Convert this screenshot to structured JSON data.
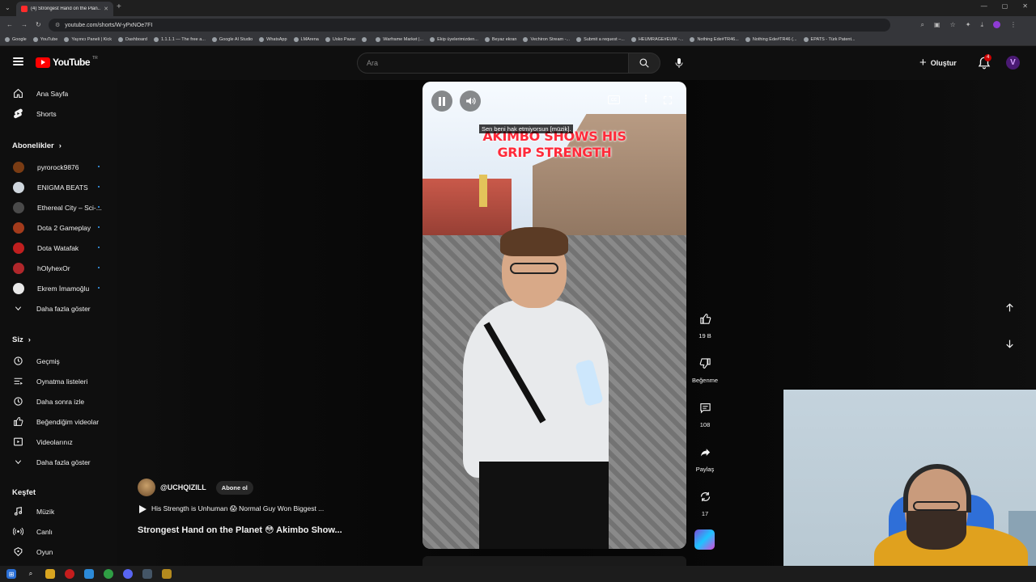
{
  "browser": {
    "tab_title": "(4) Strongest Hand on the Plan...",
    "url": "youtube.com/shorts/W-yPxNOe7FI",
    "bookmarks": [
      "Google",
      "YouTube",
      "Yayıncı Paneli | Kick",
      "Dashboard",
      "1.1.1.1 — The free a...",
      "Google AI Studio",
      "WhatsApp",
      "LMArena",
      "Usko Pazar",
      "",
      "Warframe Market |...",
      "Ekip üyelerimizden...",
      "Beyaz ekran",
      "Vechiron Stream -...",
      "Submit a request –...",
      "HEUMRAGE#EUW -...",
      "Nothing Ede#TR46...",
      "Nothing Ede#TR46 (...",
      "EPATS - Türk Patent..."
    ]
  },
  "header": {
    "logo_text": "YouTube",
    "country_code": "TR",
    "search_placeholder": "Ara",
    "create_label": "Oluştur",
    "notification_count": "4",
    "avatar_letter": "V"
  },
  "sidebar": {
    "main": [
      {
        "label": "Ana Sayfa",
        "icon": "home-icon"
      },
      {
        "label": "Shorts",
        "icon": "shorts-icon"
      }
    ],
    "subscriptions_heading": "Abonelikler",
    "subscriptions": [
      {
        "label": "pyrorock9876",
        "color": "#7a3c14"
      },
      {
        "label": "ENIGMA BEATS",
        "color": "#cfd6dd"
      },
      {
        "label": "Ethereal City – Sci-...",
        "color": "#4a4a4a"
      },
      {
        "label": "Dota 2 Gameplay",
        "color": "#a33b1c"
      },
      {
        "label": "Dota Watafak",
        "color": "#c01f1f"
      },
      {
        "label": "hOlyhexOr",
        "color": "#b0272b"
      },
      {
        "label": "Ekrem İmamoğlu",
        "color": "#e9e9e9"
      }
    ],
    "show_more_1": "Daha fazla göster",
    "you_heading": "Siz",
    "you_items": [
      {
        "label": "Geçmiş",
        "icon": "history-icon"
      },
      {
        "label": "Oynatma listeleri",
        "icon": "playlists-icon"
      },
      {
        "label": "Daha sonra izle",
        "icon": "watch-later-icon"
      },
      {
        "label": "Beğendiğim videolar",
        "icon": "liked-videos-icon"
      },
      {
        "label": "Videolarınız",
        "icon": "your-videos-icon"
      }
    ],
    "show_more_2": "Daha fazla göster",
    "explore_heading": "Keşfet",
    "explore_items": [
      {
        "label": "Müzik",
        "icon": "music-icon"
      },
      {
        "label": "Canlı",
        "icon": "live-icon"
      },
      {
        "label": "Oyun",
        "icon": "gaming-icon"
      }
    ]
  },
  "video": {
    "caption": "Sen beni hak etmiyorsun [müzik].",
    "overlay_line1": "AKIMBO SHOWS HIS",
    "overlay_line2": "GRIP STRENGTH",
    "cc_label": "CC",
    "channel_handle": "@UCHQIZILL",
    "subscribe_label": "Abone ol",
    "sound_text": "His Strength is Unhuman 😱 Normal Guy Won Biggest ...",
    "title": "Strongest Hand on the Planet 😳 Akimbo Show..."
  },
  "actions": {
    "likes": "19 B",
    "dislike_label": "Beğenme",
    "comments": "108",
    "share_label": "Paylaş",
    "remix_count": "17"
  }
}
